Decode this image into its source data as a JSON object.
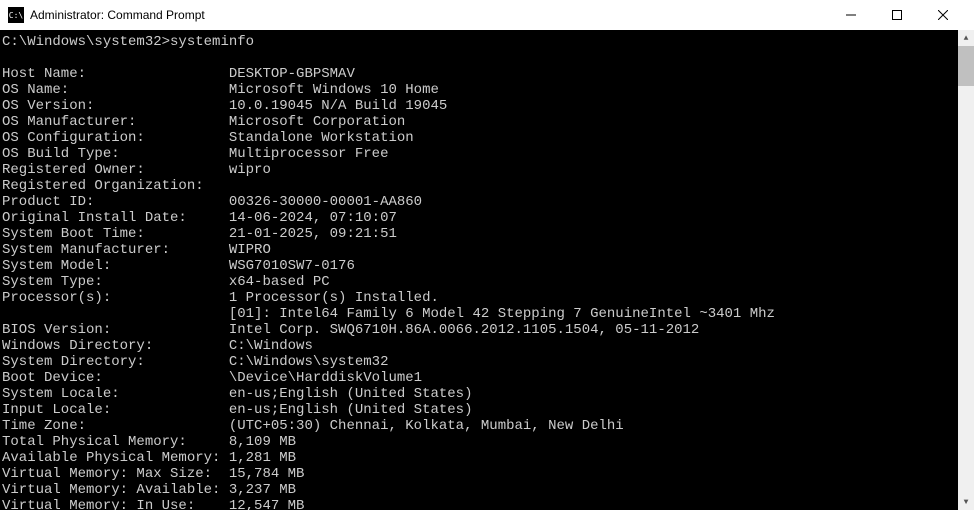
{
  "titlebar": {
    "icon_text": "C:\\",
    "title": "Administrator: Command Prompt"
  },
  "prompt": {
    "path": "C:\\Windows\\system32>",
    "command": "systeminfo"
  },
  "label_col_width": 27,
  "rows": [
    {
      "label": "Host Name:",
      "value": "DESKTOP-GBPSMAV"
    },
    {
      "label": "OS Name:",
      "value": "Microsoft Windows 10 Home"
    },
    {
      "label": "OS Version:",
      "value": "10.0.19045 N/A Build 19045"
    },
    {
      "label": "OS Manufacturer:",
      "value": "Microsoft Corporation"
    },
    {
      "label": "OS Configuration:",
      "value": "Standalone Workstation"
    },
    {
      "label": "OS Build Type:",
      "value": "Multiprocessor Free"
    },
    {
      "label": "Registered Owner:",
      "value": "wipro"
    },
    {
      "label": "Registered Organization:",
      "value": ""
    },
    {
      "label": "Product ID:",
      "value": "00326-30000-00001-AA860"
    },
    {
      "label": "Original Install Date:",
      "value": "14-06-2024, 07:10:07"
    },
    {
      "label": "System Boot Time:",
      "value": "21-01-2025, 09:21:51"
    },
    {
      "label": "System Manufacturer:",
      "value": "WIPRO"
    },
    {
      "label": "System Model:",
      "value": "WSG7010SW7-0176"
    },
    {
      "label": "System Type:",
      "value": "x64-based PC"
    },
    {
      "label": "Processor(s):",
      "value": "1 Processor(s) Installed."
    },
    {
      "label": "",
      "value": "[01]: Intel64 Family 6 Model 42 Stepping 7 GenuineIntel ~3401 Mhz"
    },
    {
      "label": "BIOS Version:",
      "value": "Intel Corp. SWQ6710H.86A.0066.2012.1105.1504, 05-11-2012"
    },
    {
      "label": "Windows Directory:",
      "value": "C:\\Windows"
    },
    {
      "label": "System Directory:",
      "value": "C:\\Windows\\system32"
    },
    {
      "label": "Boot Device:",
      "value": "\\Device\\HarddiskVolume1"
    },
    {
      "label": "System Locale:",
      "value": "en-us;English (United States)"
    },
    {
      "label": "Input Locale:",
      "value": "en-us;English (United States)"
    },
    {
      "label": "Time Zone:",
      "value": "(UTC+05:30) Chennai, Kolkata, Mumbai, New Delhi"
    },
    {
      "label": "Total Physical Memory:",
      "value": "8,109 MB"
    },
    {
      "label": "Available Physical Memory:",
      "value": "1,281 MB"
    },
    {
      "label": "Virtual Memory: Max Size:",
      "value": "15,784 MB"
    },
    {
      "label": "Virtual Memory: Available:",
      "value": "3,237 MB"
    },
    {
      "label": "Virtual Memory: In Use:",
      "value": "12,547 MB"
    }
  ]
}
